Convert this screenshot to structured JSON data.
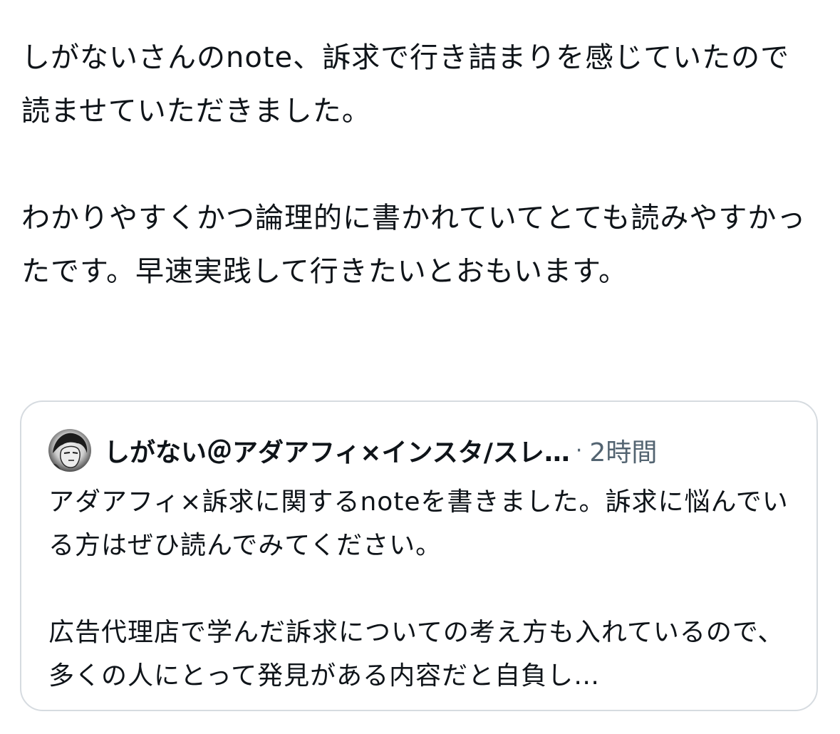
{
  "tweet": {
    "paragraph1": "しがないさんのnote、訴求で行き詰まりを感じていたので読ませていただきました。",
    "paragraph2": "わかりやすくかつ論理的に書かれていてとても読みやすかったです。早速実践して行きたいとおもいます。"
  },
  "quote": {
    "author_name": "しがない＠アダアフィ×インスタ/スレ…",
    "separator": "·",
    "time": "2時間",
    "paragraph1": "アダアフィ×訴求に関するnoteを書きました。訴求に悩んでいる方はぜひ読んでみてください。",
    "paragraph2": "広告代理店で学んだ訴求についての考え方も入れているので、多くの人にとって発見がある内容だと自負し…",
    "avatar_icon": "avatar-illustration"
  },
  "colors": {
    "text": "#0f1419",
    "secondary_text": "#536471",
    "card_border": "#d6dbe0",
    "background": "#ffffff"
  }
}
